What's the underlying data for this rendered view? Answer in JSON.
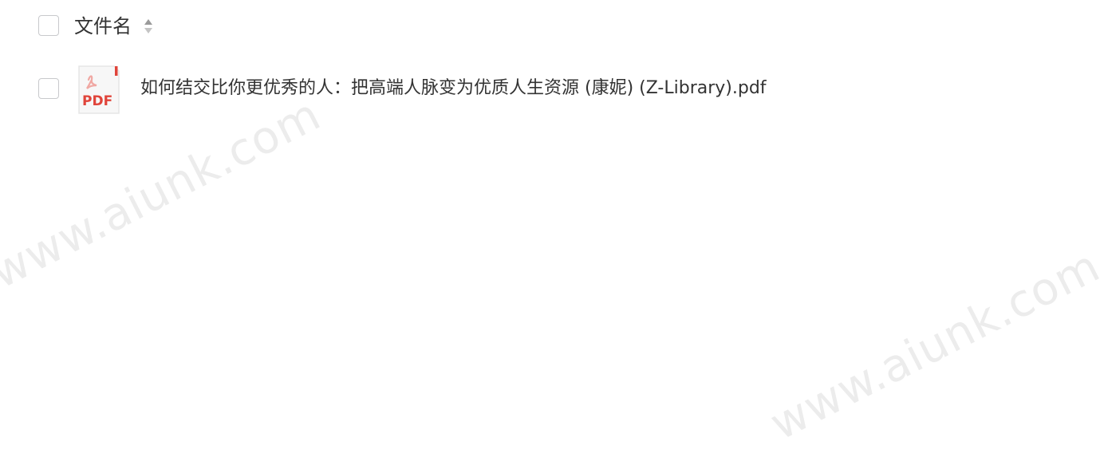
{
  "file_list": {
    "header": {
      "column_title": "文件名"
    },
    "files": [
      {
        "name": "如何结交比你更优秀的人：把高端人脉变为优质人生资源 (康妮) (Z-Library).pdf",
        "type_label": "PDF",
        "icon": "pdf-file-icon"
      }
    ]
  },
  "watermarks": [
    "www.aiunk.com",
    "www.aiunk.com"
  ],
  "colors": {
    "text": "#333333",
    "checkbox_border": "#c8c9cc",
    "pdf_red": "#e0443a"
  }
}
